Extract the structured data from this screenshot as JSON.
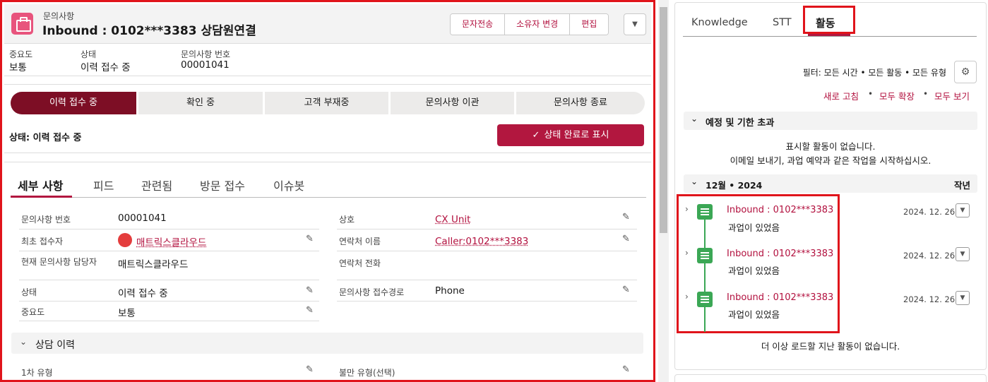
{
  "record": {
    "object_label": "문의사항",
    "title": "Inbound : 0102***3383 상담원연결"
  },
  "header_actions": {
    "sms": "문자전송",
    "change_owner": "소유자 변경",
    "edit": "편집"
  },
  "highlights": [
    {
      "label": "중요도",
      "value": "보통"
    },
    {
      "label": "상태",
      "value": "이력 접수 중"
    },
    {
      "label": "문의사항 번호",
      "value": "00001041"
    }
  ],
  "path": {
    "steps": [
      "이력 접수 중",
      "확인 중",
      "고객 부재중",
      "문의사항 이관",
      "문의사항 종료"
    ],
    "status_text": "상태: 이력 접수 중",
    "complete_button": "상태 완료로 표시"
  },
  "detail_tabs": [
    "세부 사항",
    "피드",
    "관련됨",
    "방문 접수",
    "이슈봇"
  ],
  "fields_left": [
    {
      "label": "문의사항 번호",
      "value": "00001041"
    },
    {
      "label": "최초 접수자",
      "value": "매트릭스클라우드"
    },
    {
      "label": "현재 문의사항 담당자",
      "value": "매트릭스클라우드"
    },
    {
      "label": "상태",
      "value": "이력 접수 중"
    },
    {
      "label": "중요도",
      "value": "보통"
    }
  ],
  "fields_right": [
    {
      "label": "상호",
      "value": "CX Unit"
    },
    {
      "label": "연락처 이름",
      "value": "Caller:0102***3383"
    },
    {
      "label": "연락처 전화",
      "value": ""
    },
    {
      "label": "문의사항 접수경로",
      "value": "Phone"
    }
  ],
  "counsel_section": {
    "title": "상담 이력",
    "field1": "1차 유형",
    "field2": "불만 유형(선택)"
  },
  "right_tabs": [
    "Knowledge",
    "STT",
    "활동"
  ],
  "activity": {
    "filter": "필터: 모든 시간 • 모든 활동 • 모든 유형",
    "refresh": "새로 고침",
    "expand": "모두 확장",
    "view_all": "모두 보기",
    "upcoming_title": "예정 및 기한 초과",
    "empty1": "표시할 활동이 없습니다.",
    "empty2": "이메일 보내기, 과업 예약과 같은 작업을 시작하십시오.",
    "month_title": "12월 • 2024",
    "month_tag": "작년",
    "items": [
      {
        "title": "Inbound : 0102***3383",
        "desc": "과업이 있었음",
        "date": "2024. 12. 26."
      },
      {
        "title": "Inbound : 0102***3383",
        "desc": "과업이 있었음",
        "date": "2024. 12. 26."
      },
      {
        "title": "Inbound : 0102***3383",
        "desc": "과업이 있었음",
        "date": "2024. 12. 26."
      }
    ],
    "no_more": "더 이상 로드할 지난 활동이 없습니다."
  }
}
